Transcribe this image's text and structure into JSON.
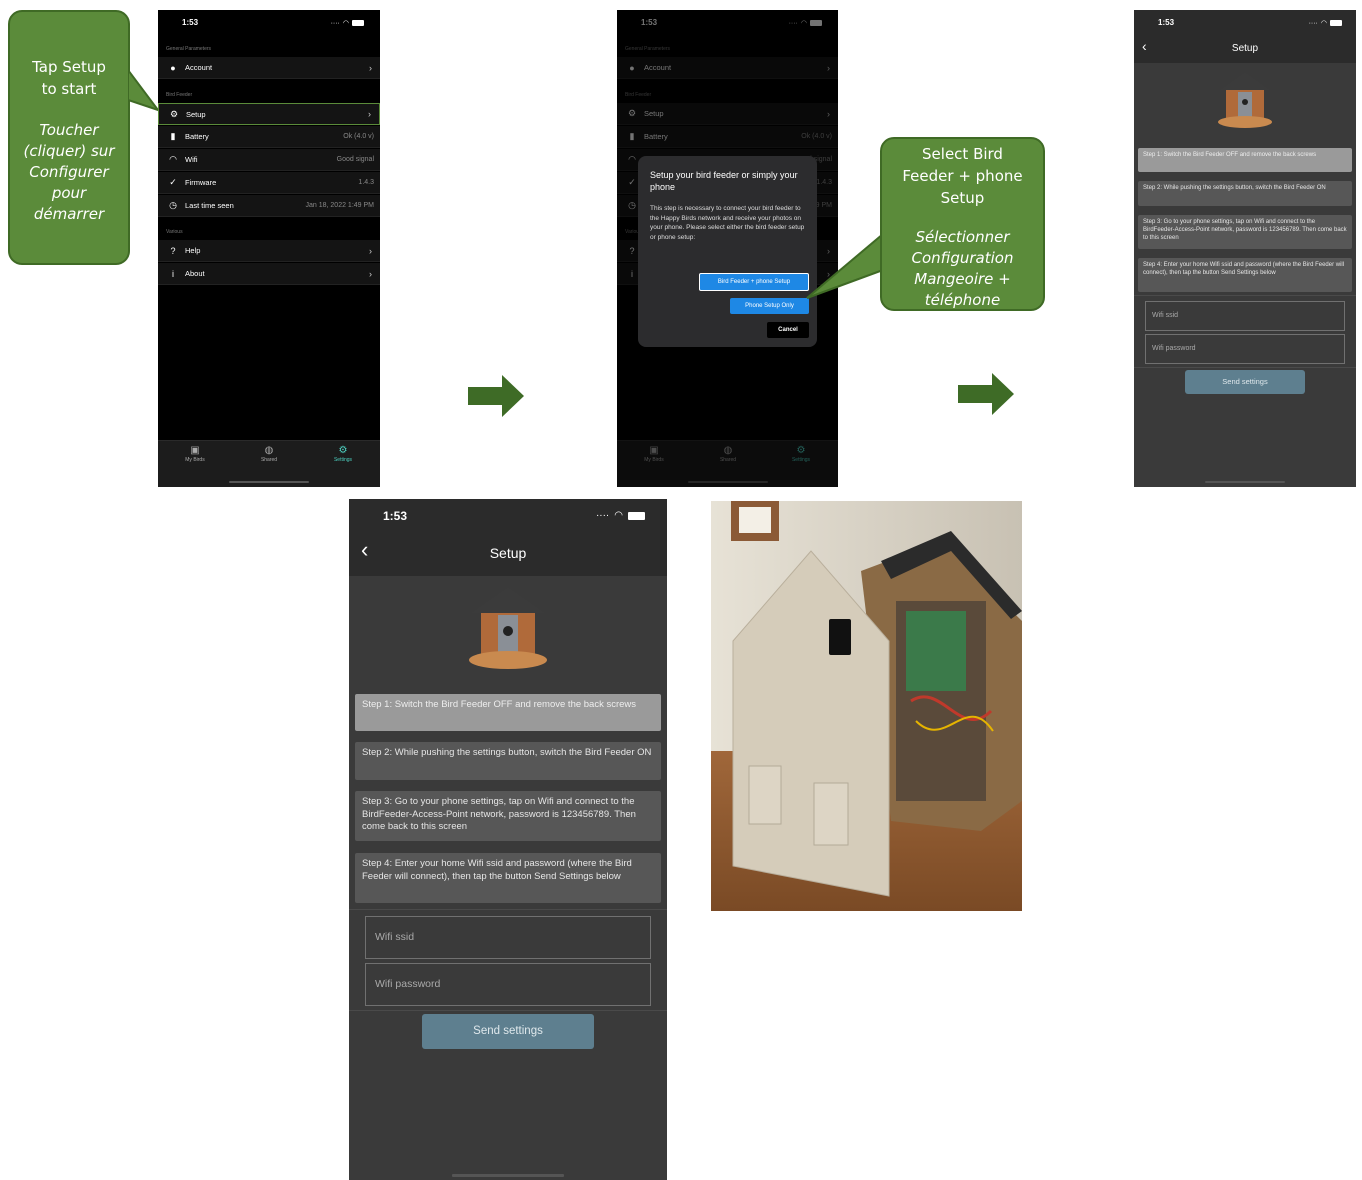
{
  "callout_start": {
    "en_line1": "Tap Setup",
    "en_line2": "to start",
    "fr_lines": [
      "Toucher",
      "(cliquer) sur",
      "Configurer",
      "pour",
      "démarrer"
    ]
  },
  "callout_select": {
    "en_lines": [
      "Select Bird",
      "Feeder + phone",
      "Setup"
    ],
    "fr_lines": [
      "Sélectionner",
      "Configuration",
      "Mangeoire +",
      "téléphone"
    ]
  },
  "status": {
    "time": "1:53"
  },
  "settings": {
    "section_general": "General Parameters",
    "account": "Account",
    "section_feeder": "Bird Feeder",
    "setup": "Setup",
    "battery": "Battery",
    "battery_value": "Ok (4.0 v)",
    "wifi": "Wifi",
    "wifi_value": "Good signal",
    "firmware": "Firmware",
    "firmware_value": "1.4.3",
    "last_seen": "Last time seen",
    "last_seen_value": "Jan 18, 2022 1:49 PM",
    "section_various": "Various",
    "help": "Help",
    "about": "About"
  },
  "tabs": {
    "my_birds": "My Birds",
    "shared": "Shared",
    "settings": "Settings"
  },
  "dialog": {
    "title": "Setup your bird feeder or simply your phone",
    "body": "This step is necessary to connect your bird feeder to the Happy Birds network and receive your photos on your phone. Please select either the bird feeder setup or phone setup:",
    "btn_feeder": "Bird Feeder + phone Setup",
    "btn_phone": "Phone Setup Only",
    "btn_cancel": "Cancel"
  },
  "setup": {
    "title": "Setup",
    "step1": "Step 1: Switch the Bird Feeder OFF and remove the back screws",
    "step2": "Step 2: While pushing the settings button, switch the Bird Feeder ON",
    "step3": "Step 3: Go to your phone settings, tap on Wifi and connect to the BirdFeeder-Access-Point network, password is 123456789. Then come back to this screen",
    "step4": "Step 4: Enter your home Wifi ssid and password (where the Bird Feeder will connect), then tap the button Send Settings below",
    "ssid_placeholder": "Wifi ssid",
    "password_placeholder": "Wifi password",
    "send": "Send settings"
  },
  "colors": {
    "callout_green": "#5b8b3a",
    "arrow_green": "#3e6b26",
    "accent_teal": "#4dd0c0",
    "dialog_blue": "#1e88e5"
  }
}
